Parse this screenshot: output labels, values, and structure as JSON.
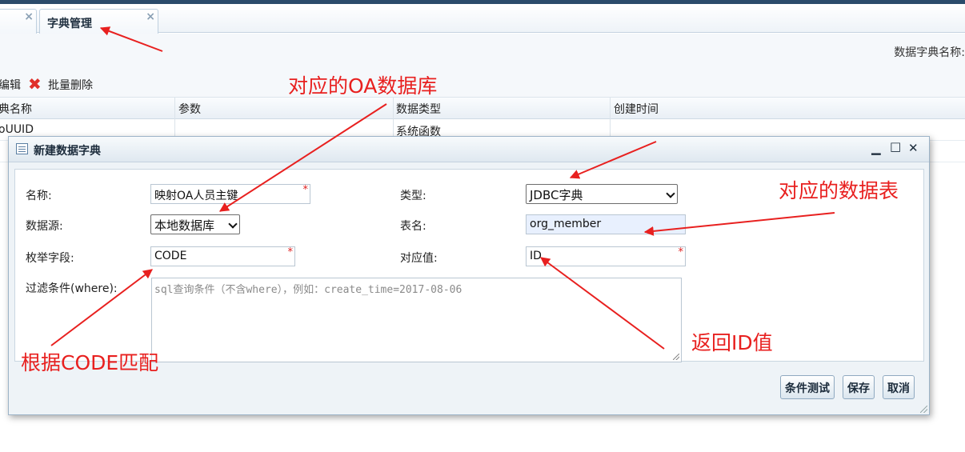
{
  "tabs": [
    {
      "label": "",
      "close_icon": "×"
    },
    {
      "label": "字典管理",
      "close_icon": "×"
    }
  ],
  "search": {
    "label": "数据字典名称:"
  },
  "toolbar": {
    "edit_label": "编辑",
    "delete_icon": "✖",
    "batch_delete_label": "批量删除"
  },
  "grid": {
    "headers": [
      "典名称",
      "参数",
      "数据类型",
      "创建时间"
    ],
    "rows": [
      {
        "name": "oUUID",
        "param": "",
        "type": "系统函数",
        "created": ""
      }
    ]
  },
  "dialog": {
    "title": "新建数据字典",
    "window_buttons": {
      "minimize": "▁",
      "maximize": "□",
      "close": "✕"
    },
    "fields": {
      "name": {
        "label": "名称:",
        "value": "映射OA人员主键"
      },
      "type": {
        "label": "类型:",
        "value": "JDBC字典"
      },
      "datasource": {
        "label": "数据源:",
        "value": "本地数据库"
      },
      "table": {
        "label": "表名:",
        "value": "org_member"
      },
      "enum_field": {
        "label": "枚举字段:",
        "value": "CODE"
      },
      "value_field": {
        "label": "对应值:",
        "value": "ID"
      },
      "where": {
        "label": "过滤条件(where):",
        "placeholder": "sql查询条件（不含where），例如：create_time=2017-08-06"
      }
    },
    "required_mark": "*",
    "buttons": {
      "test": "条件测试",
      "save": "保存",
      "cancel": "取消"
    }
  },
  "annotations": {
    "oa_db": "对应的OA数据库",
    "table": "对应的数据表",
    "code": "根据CODE匹配",
    "id": "返回ID值"
  },
  "colors": {
    "annotation": "#e8201f",
    "accent": "#2b4b6b"
  }
}
